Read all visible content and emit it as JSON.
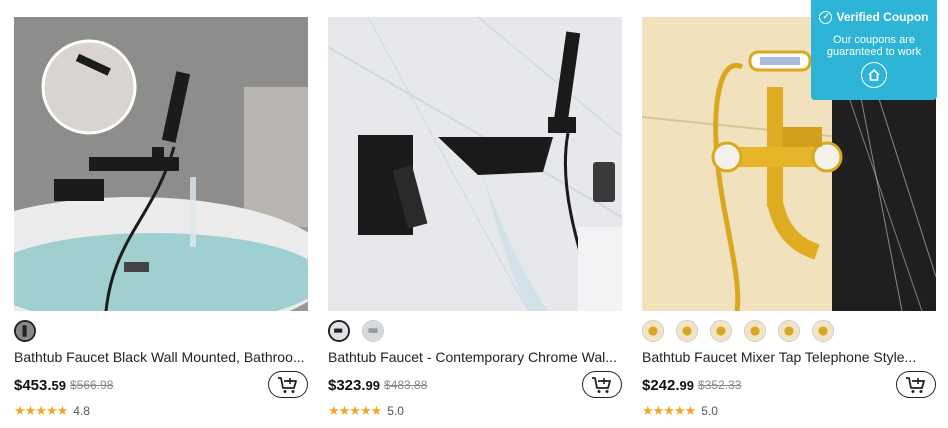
{
  "products": [
    {
      "title": "Bathtub Faucet Black Wall Mounted, Bathroo...",
      "price_main": "$453.",
      "price_cents": "59",
      "original_price": "$566.98",
      "stars": "★★★★★",
      "rating": "4.8",
      "swatch_count": 1,
      "image_icon": "black-wall-bathtub-faucet"
    },
    {
      "title": "Bathtub Faucet - Contemporary Chrome Wal...",
      "price_main": "$323.",
      "price_cents": "99",
      "original_price": "$483.88",
      "stars": "★★★★★",
      "rating": "5.0",
      "swatch_count": 2,
      "image_icon": "black-waterfall-faucet"
    },
    {
      "title": "Bathtub Faucet Mixer Tap Telephone Style...",
      "price_main": "$242.",
      "price_cents": "99",
      "original_price": "$352.33",
      "stars": "★★★★★",
      "rating": "5.0",
      "swatch_count": 6,
      "image_icon": "gold-telephone-faucet"
    }
  ],
  "coupon": {
    "title": "Verified Coupon",
    "text_line1": "Our coupons are",
    "text_line2": "guaranteed to work",
    "color": "#2db4d6"
  },
  "colors": {
    "star": "#f5a623",
    "price": "#111111",
    "original_price": "#888888"
  }
}
